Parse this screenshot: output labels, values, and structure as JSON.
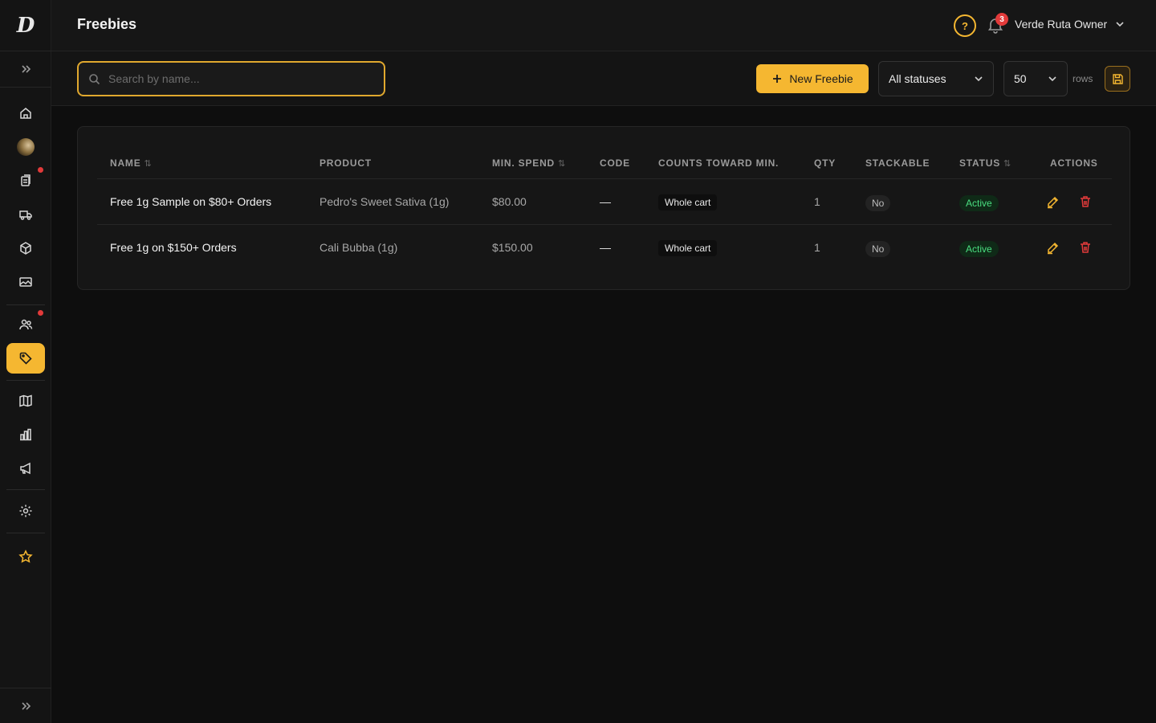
{
  "brand": {
    "logo_text": "D",
    "accent": "#f5b731"
  },
  "header": {
    "title": "Freebies",
    "notification_count": "3",
    "user_label": "Verde Ruta Owner"
  },
  "toolbar": {
    "search_placeholder": "Search by name...",
    "new_button_label": "New Freebie",
    "status_filter": "All statuses",
    "page_size": "50",
    "rows_label": "rows"
  },
  "sidebar": {
    "items": [
      {
        "icon": "home-icon"
      },
      {
        "icon": "avatar-image"
      },
      {
        "icon": "orders-icon",
        "alert": true
      },
      {
        "icon": "delivery-truck-icon"
      },
      {
        "icon": "package-icon"
      },
      {
        "icon": "image-gallery-icon"
      },
      {
        "icon": "users-icon",
        "alert": true
      },
      {
        "icon": "tag-icon",
        "active": true
      },
      {
        "icon": "map-icon"
      },
      {
        "icon": "bar-chart-icon"
      },
      {
        "icon": "megaphone-icon"
      },
      {
        "icon": "gear-icon"
      },
      {
        "icon": "star-icon"
      }
    ]
  },
  "table": {
    "columns": [
      "NAME",
      "PRODUCT",
      "MIN. SPEND",
      "CODE",
      "COUNTS TOWARD MIN.",
      "QTY",
      "STACKABLE",
      "STATUS",
      "ACTIONS"
    ],
    "rows": [
      {
        "name": "Free 1g Sample on $80+ Orders",
        "product": "Pedro's Sweet Sativa (1g)",
        "min_spend": "$80.00",
        "code": "—",
        "counts_toward": "Whole cart",
        "qty": "1",
        "stackable": "No",
        "status": "Active"
      },
      {
        "name": "Free 1g on $150+ Orders",
        "product": "Cali Bubba (1g)",
        "min_spend": "$150.00",
        "code": "—",
        "counts_toward": "Whole cart",
        "qty": "1",
        "stackable": "No",
        "status": "Active"
      }
    ]
  },
  "colors": {
    "status_active": "#4ade80",
    "delete": "#e23a3a",
    "edit": "#f5b731"
  }
}
